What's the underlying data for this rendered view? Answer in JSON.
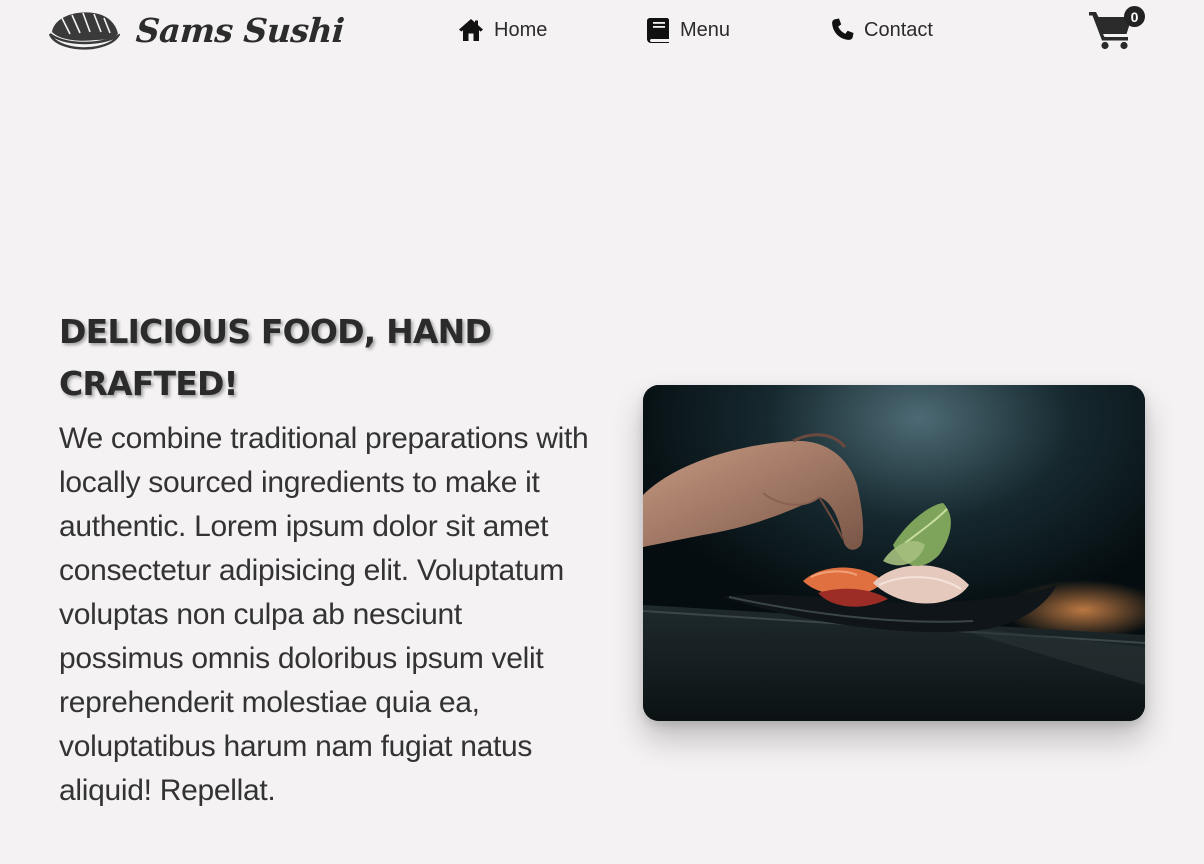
{
  "brand": {
    "name": "Sams Sushi",
    "logo_icon": "sushi-nigiri-icon"
  },
  "nav": {
    "items": [
      {
        "label": "Home",
        "icon": "home-icon"
      },
      {
        "label": "Menu",
        "icon": "book-icon"
      },
      {
        "label": "Contact",
        "icon": "phone-icon"
      }
    ],
    "cart": {
      "icon": "cart-icon",
      "count": "0"
    }
  },
  "hero": {
    "title": "DELICIOUS FOOD, HAND CRAFTED!",
    "body": "We combine traditional preparations with locally sourced ingredients to make it authentic. Lorem ipsum dolor sit amet consectetur adipisicing elit. Voluptatum voluptas non culpa ab nesciunt possimus omnis doloribus ipsum velit reprehenderit molestiae quia ea, voluptatibus harum nam fugiat natus aliquid! Repellat.",
    "image": "chef-plating-sushi-photo"
  },
  "colors": {
    "background": "#f4f2f3",
    "text": "#2b2b2b",
    "badge": "#222222"
  }
}
